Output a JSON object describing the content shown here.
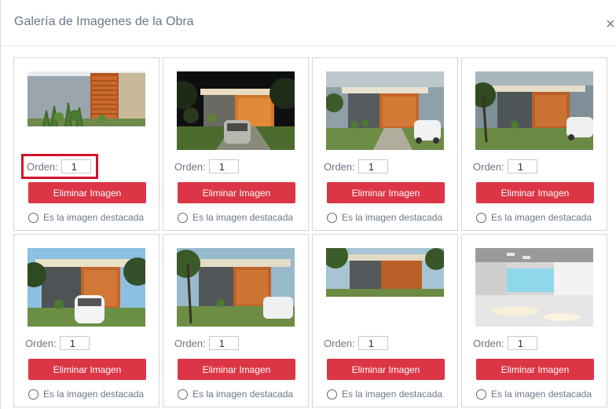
{
  "modal": {
    "title": "Galería de Imagenes de la Obra",
    "close_label": "×"
  },
  "cards": [
    {
      "order_label": "Orden:",
      "order_value": "1",
      "delete_label": "Eliminar Imagen",
      "featured_label": "Es la imagen destacada",
      "image": "house-facade-closeup"
    },
    {
      "order_label": "Orden:",
      "order_value": "1",
      "delete_label": "Eliminar Imagen",
      "featured_label": "Es la imagen destacada",
      "image": "house-night-car"
    },
    {
      "order_label": "Orden:",
      "order_value": "1",
      "delete_label": "Eliminar Imagen",
      "featured_label": "Es la imagen destacada",
      "image": "house-day-white-car"
    },
    {
      "order_label": "Orden:",
      "order_value": "1",
      "delete_label": "Eliminar Imagen",
      "featured_label": "Es la imagen destacada",
      "image": "house-day-palm"
    },
    {
      "order_label": "Orden:",
      "order_value": "1",
      "delete_label": "Eliminar Imagen",
      "featured_label": "Es la imagen destacada",
      "image": "house-front-white-car"
    },
    {
      "order_label": "Orden:",
      "order_value": "1",
      "delete_label": "Eliminar Imagen",
      "featured_label": "Es la imagen destacada",
      "image": "house-palm-front"
    },
    {
      "order_label": "Orden:",
      "order_value": "1",
      "delete_label": "Eliminar Imagen",
      "featured_label": "Es la imagen destacada",
      "image": "house-wide-palm"
    },
    {
      "order_label": "Orden:",
      "order_value": "1",
      "delete_label": "Eliminar Imagen",
      "featured_label": "Es la imagen destacada",
      "image": "interior-white-room"
    }
  ],
  "colors": {
    "danger": "#dc3545",
    "highlight": "#d0142a"
  }
}
